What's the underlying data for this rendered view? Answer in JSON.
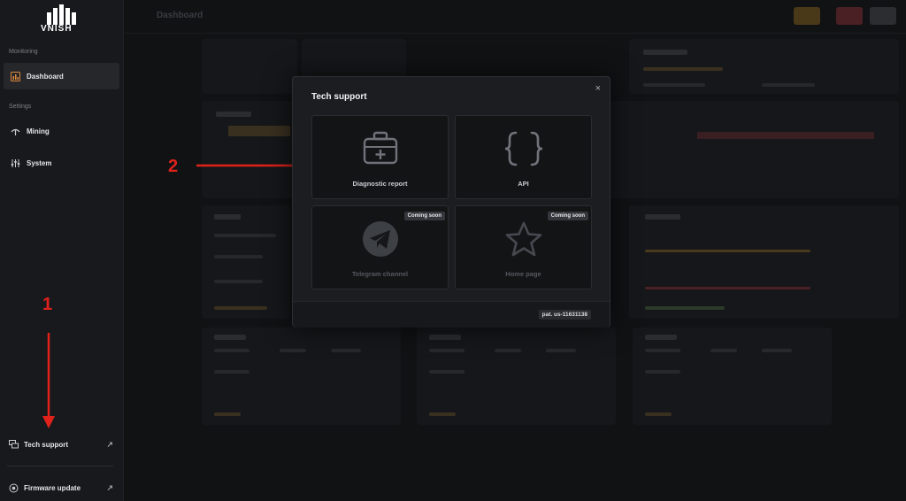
{
  "app": {
    "logo_text": "VNISH"
  },
  "sidebar": {
    "section_monitoring": "Monitoring",
    "section_settings": "Settings",
    "items": [
      {
        "label": "Dashboard"
      },
      {
        "label": "Mining"
      },
      {
        "label": "System"
      }
    ],
    "tech_support": "Tech support",
    "firmware_update": "Firmware update"
  },
  "main": {
    "title": "Dashboard"
  },
  "annotations": {
    "step1": "1",
    "step2": "2"
  },
  "modal": {
    "title": "Tech support",
    "close_glyph": "×",
    "tiles": [
      {
        "label": "Diagnostic report",
        "icon": "medkit-icon"
      },
      {
        "label": "API",
        "icon": "braces-icon"
      },
      {
        "label": "Telegram channel",
        "icon": "telegram-icon",
        "badge": "Coming soon"
      },
      {
        "label": "Home page",
        "icon": "star-icon",
        "badge": "Coming soon"
      }
    ],
    "version": "pat. us-11631138"
  },
  "colors": {
    "annotation_red": "#e0221b",
    "accent_orange": "#c9872a",
    "accent_red": "#c0393f"
  }
}
